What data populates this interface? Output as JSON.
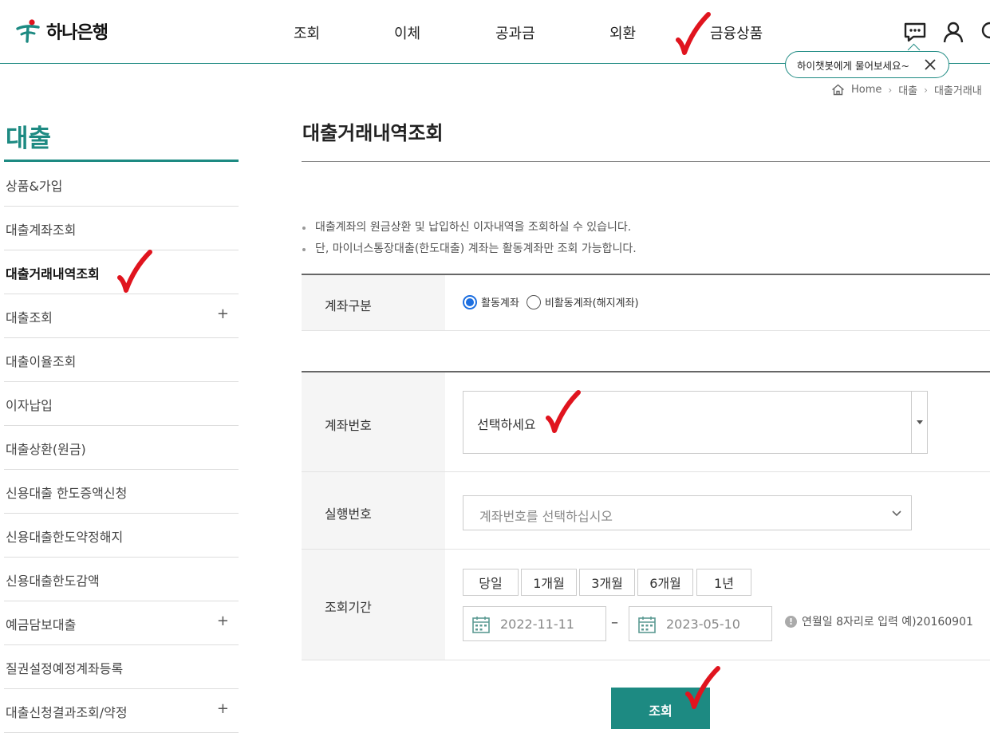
{
  "colors": {
    "brand": "#1d8a82",
    "radio_active": "#1d6fe0",
    "annotation": "#e0141e"
  },
  "header": {
    "logo_text": "하나은행",
    "nav": [
      "조회",
      "이체",
      "공과금",
      "외환",
      "금융상품"
    ],
    "icons": [
      "chatbot-icon",
      "user-icon",
      "search-icon"
    ],
    "chat_tooltip": "하이챗봇에게 물어보세요~"
  },
  "breadcrumb": [
    "Home",
    "대출",
    "대출거래내"
  ],
  "sidebar": {
    "title": "대출",
    "items": [
      {
        "label": "상품&가입"
      },
      {
        "label": "대출계좌조회"
      },
      {
        "label": "대출거래내역조회",
        "active": true
      },
      {
        "label": "대출조회",
        "expand": "+"
      },
      {
        "label": "대출이율조회"
      },
      {
        "label": "이자납입"
      },
      {
        "label": "대출상환(원금)"
      },
      {
        "label": "신용대출 한도증액신청"
      },
      {
        "label": "신용대출한도약정해지"
      },
      {
        "label": "신용대출한도감액"
      },
      {
        "label": "예금담보대출",
        "expand": "+"
      },
      {
        "label": "질권설정예정계좌등록"
      },
      {
        "label": "대출신청결과조회/약정",
        "expand": "+"
      }
    ]
  },
  "main": {
    "title": "대출거래내역조회",
    "notices": [
      "대출계좌의 원금상환 및 납입하신 이자내역을 조회하실 수 있습니다.",
      "단, 마이너스통장대출(한도대출) 계좌는 활동계좌만 조회 가능합니다."
    ],
    "account_type": {
      "label": "계좌구분",
      "options": [
        "활동계좌",
        "비활동계좌(해지계좌)"
      ],
      "selected": "활동계좌"
    },
    "account_number": {
      "label": "계좌번호",
      "value": "선택하세요"
    },
    "exec_number": {
      "label": "실행번호",
      "value": "계좌번호를 선택하십시오"
    },
    "period": {
      "label": "조회기간",
      "buttons": [
        "당일",
        "1개월",
        "3개월",
        "6개월",
        "1년"
      ],
      "from": "2022-11-11",
      "to": "2023-05-10",
      "separator": "–",
      "hint_icon": "!",
      "hint": "연월일 8자리로 입력 예)20160901"
    },
    "search_label": "조회"
  }
}
